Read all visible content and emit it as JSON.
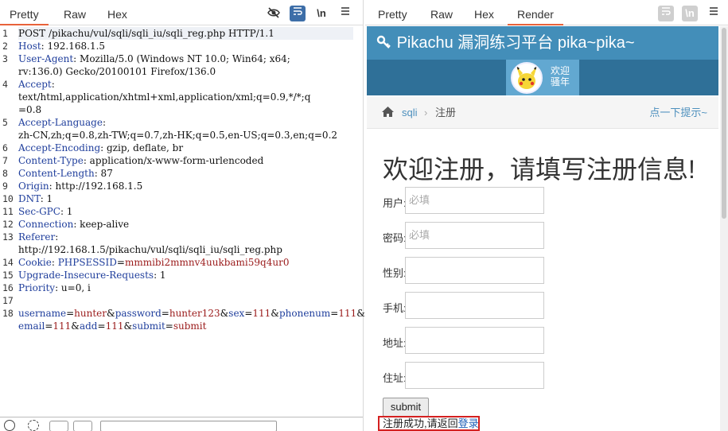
{
  "left_tabs": [
    "Pretty",
    "Raw",
    "Hex"
  ],
  "left_tools": {
    "eye_off": "eye-off-icon",
    "wrap": "wrap-icon",
    "newline_label": "\\n",
    "menu": "menu-icon"
  },
  "request_lines": [
    {
      "n": "1",
      "segments": [
        {
          "t": "POST /pikachu/vul/sqli/sqli_iu/sqli_reg.php HTTP/1.1",
          "c": ""
        }
      ]
    },
    {
      "n": "2",
      "segments": [
        {
          "t": "Host",
          "c": "k"
        },
        {
          "t": ": 192.168.1.5",
          "c": ""
        }
      ]
    },
    {
      "n": "3",
      "segments": [
        {
          "t": "User-Agent",
          "c": "k"
        },
        {
          "t": ": Mozilla/5.0 (Windows NT 10.0; Win64; x64;",
          "c": ""
        }
      ]
    },
    {
      "n": "",
      "segments": [
        {
          "t": "rv:136.0) Gecko/20100101 Firefox/136.0",
          "c": ""
        }
      ]
    },
    {
      "n": "4",
      "segments": [
        {
          "t": "Accept",
          "c": "k"
        },
        {
          "t": ":",
          "c": ""
        }
      ]
    },
    {
      "n": "",
      "segments": [
        {
          "t": "text/html,application/xhtml+xml,application/xml;q=0.9,*/*;q",
          "c": ""
        }
      ]
    },
    {
      "n": "",
      "segments": [
        {
          "t": "=0.8",
          "c": ""
        }
      ]
    },
    {
      "n": "5",
      "segments": [
        {
          "t": "Accept-Language",
          "c": "k"
        },
        {
          "t": ":",
          "c": ""
        }
      ]
    },
    {
      "n": "",
      "segments": [
        {
          "t": "zh-CN,zh;q=0.8,zh-TW;q=0.7,zh-HK;q=0.5,en-US;q=0.3,en;q=0.2",
          "c": ""
        }
      ]
    },
    {
      "n": "6",
      "segments": [
        {
          "t": "Accept-Encoding",
          "c": "k"
        },
        {
          "t": ": gzip, deflate, br",
          "c": ""
        }
      ]
    },
    {
      "n": "7",
      "segments": [
        {
          "t": "Content-Type",
          "c": "k"
        },
        {
          "t": ": application/x-www-form-urlencoded",
          "c": ""
        }
      ]
    },
    {
      "n": "8",
      "segments": [
        {
          "t": "Content-Length",
          "c": "k"
        },
        {
          "t": ": 87",
          "c": ""
        }
      ]
    },
    {
      "n": "9",
      "segments": [
        {
          "t": "Origin",
          "c": "k"
        },
        {
          "t": ": http://192.168.1.5",
          "c": ""
        }
      ]
    },
    {
      "n": "10",
      "segments": [
        {
          "t": "DNT",
          "c": "k"
        },
        {
          "t": ": 1",
          "c": ""
        }
      ]
    },
    {
      "n": "11",
      "segments": [
        {
          "t": "Sec-GPC",
          "c": "k"
        },
        {
          "t": ": 1",
          "c": ""
        }
      ]
    },
    {
      "n": "12",
      "segments": [
        {
          "t": "Connection",
          "c": "k"
        },
        {
          "t": ": keep-alive",
          "c": ""
        }
      ]
    },
    {
      "n": "13",
      "segments": [
        {
          "t": "Referer",
          "c": "k"
        },
        {
          "t": ":",
          "c": ""
        }
      ]
    },
    {
      "n": "",
      "segments": [
        {
          "t": "http://192.168.1.5/pikachu/vul/sqli/sqli_iu/sqli_reg.php",
          "c": ""
        }
      ]
    },
    {
      "n": "14",
      "segments": [
        {
          "t": "Cookie",
          "c": "k"
        },
        {
          "t": ": ",
          "c": ""
        },
        {
          "t": "PHPSESSID",
          "c": "pk"
        },
        {
          "t": "=",
          "c": ""
        },
        {
          "t": "mmmibi2mmnv4uukbami59q4ur0",
          "c": "pv"
        }
      ]
    },
    {
      "n": "15",
      "segments": [
        {
          "t": "Upgrade-Insecure-Requests",
          "c": "k"
        },
        {
          "t": ": 1",
          "c": ""
        }
      ]
    },
    {
      "n": "16",
      "segments": [
        {
          "t": "Priority",
          "c": "k"
        },
        {
          "t": ": u=0, i",
          "c": ""
        }
      ]
    },
    {
      "n": "17",
      "segments": [
        {
          "t": "",
          "c": ""
        }
      ]
    },
    {
      "n": "18",
      "segments": [
        {
          "t": "username",
          "c": "pk"
        },
        {
          "t": "=",
          "c": ""
        },
        {
          "t": "hunter",
          "c": "pv"
        },
        {
          "t": "&",
          "c": ""
        },
        {
          "t": "password",
          "c": "pk"
        },
        {
          "t": "=",
          "c": ""
        },
        {
          "t": "hunter123",
          "c": "pv"
        },
        {
          "t": "&",
          "c": ""
        },
        {
          "t": "sex",
          "c": "pk"
        },
        {
          "t": "=",
          "c": ""
        },
        {
          "t": "111",
          "c": "pv"
        },
        {
          "t": "&",
          "c": ""
        },
        {
          "t": "phonenum",
          "c": "pk"
        },
        {
          "t": "=",
          "c": ""
        },
        {
          "t": "111",
          "c": "pv"
        },
        {
          "t": "&",
          "c": ""
        }
      ]
    },
    {
      "n": "",
      "segments": [
        {
          "t": "email",
          "c": "pk"
        },
        {
          "t": "=",
          "c": ""
        },
        {
          "t": "111",
          "c": "pv"
        },
        {
          "t": "&",
          "c": ""
        },
        {
          "t": "add",
          "c": "pk"
        },
        {
          "t": "=",
          "c": ""
        },
        {
          "t": "111",
          "c": "pv"
        },
        {
          "t": "&",
          "c": ""
        },
        {
          "t": "submit",
          "c": "pk"
        },
        {
          "t": "=",
          "c": ""
        },
        {
          "t": "submit",
          "c": "pv"
        }
      ]
    }
  ],
  "right_tabs": [
    "Pretty",
    "Raw",
    "Hex",
    "Render"
  ],
  "right_tools": {
    "wrap": "wrap-icon",
    "newline_label": "\\n",
    "menu": "menu-icon"
  },
  "site": {
    "title": "Pikachu 漏洞练习平台 pika~pika~",
    "welcome_line1": "欢迎",
    "welcome_line2": "骚年",
    "crumb_sqli": "sqli",
    "crumb_current": "注册",
    "hint": "点一下提示~",
    "heading": "欢迎注册，请填写注册信息!",
    "fields": [
      {
        "label": "用户:",
        "placeholder": "必填"
      },
      {
        "label": "密码:",
        "placeholder": "必填"
      },
      {
        "label": "性别:",
        "placeholder": ""
      },
      {
        "label": "手机:",
        "placeholder": ""
      },
      {
        "label": "地址:",
        "placeholder": ""
      },
      {
        "label": "住址:",
        "placeholder": ""
      }
    ],
    "submit_label": "submit",
    "result_text": "注册成功,请返回",
    "result_link": "登录"
  },
  "colors": {
    "header": "#438eb9",
    "nav": "#2f7098",
    "accent": "#e8623a",
    "result_border": "#d42020"
  }
}
